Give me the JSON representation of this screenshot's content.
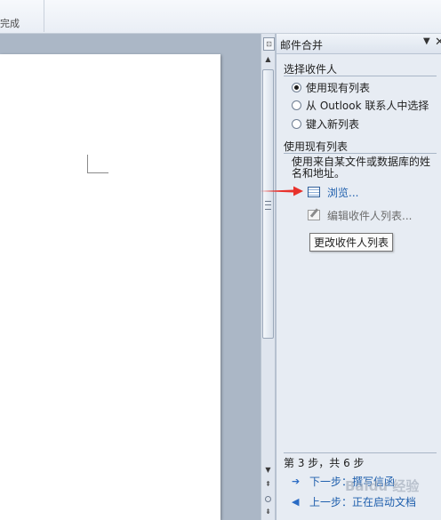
{
  "ribbon": {
    "group_label": "完成"
  },
  "pane": {
    "title": "邮件合并",
    "dropdown_glyph": "▼",
    "close_glyph": "✕",
    "select_section": {
      "title": "选择收件人",
      "options": [
        {
          "label": "使用现有列表",
          "checked": true
        },
        {
          "label": "从 Outlook 联系人中选择",
          "checked": false
        },
        {
          "label": "键入新列表",
          "checked": false
        }
      ]
    },
    "existing_section": {
      "title": "使用现有列表",
      "description": "使用来自某文件或数据库的姓名和地址。",
      "browse_label": "浏览...",
      "edit_label": "编辑收件人列表...",
      "tooltip": "更改收件人列表"
    },
    "step": {
      "text": "第 3 步，共 6 步",
      "next_label": "下一步：撰写信函",
      "prev_label": "上一步：正在启动文档"
    }
  },
  "scrollbar": {
    "split_glyph": "⊡",
    "up_glyph": "▲",
    "down_glyph": "▼",
    "prev_page_glyph": "⇞",
    "next_page_glyph": "⇟"
  },
  "watermark": "Baidu 经验",
  "colors": {
    "link": "#1f5fad",
    "arrow": "#e8322c",
    "pane_bg": "#e7ecf3"
  },
  "icons": [
    "table-icon",
    "edit-list-icon",
    "arrow-right-icon",
    "arrow-left-icon",
    "radio-icon"
  ]
}
